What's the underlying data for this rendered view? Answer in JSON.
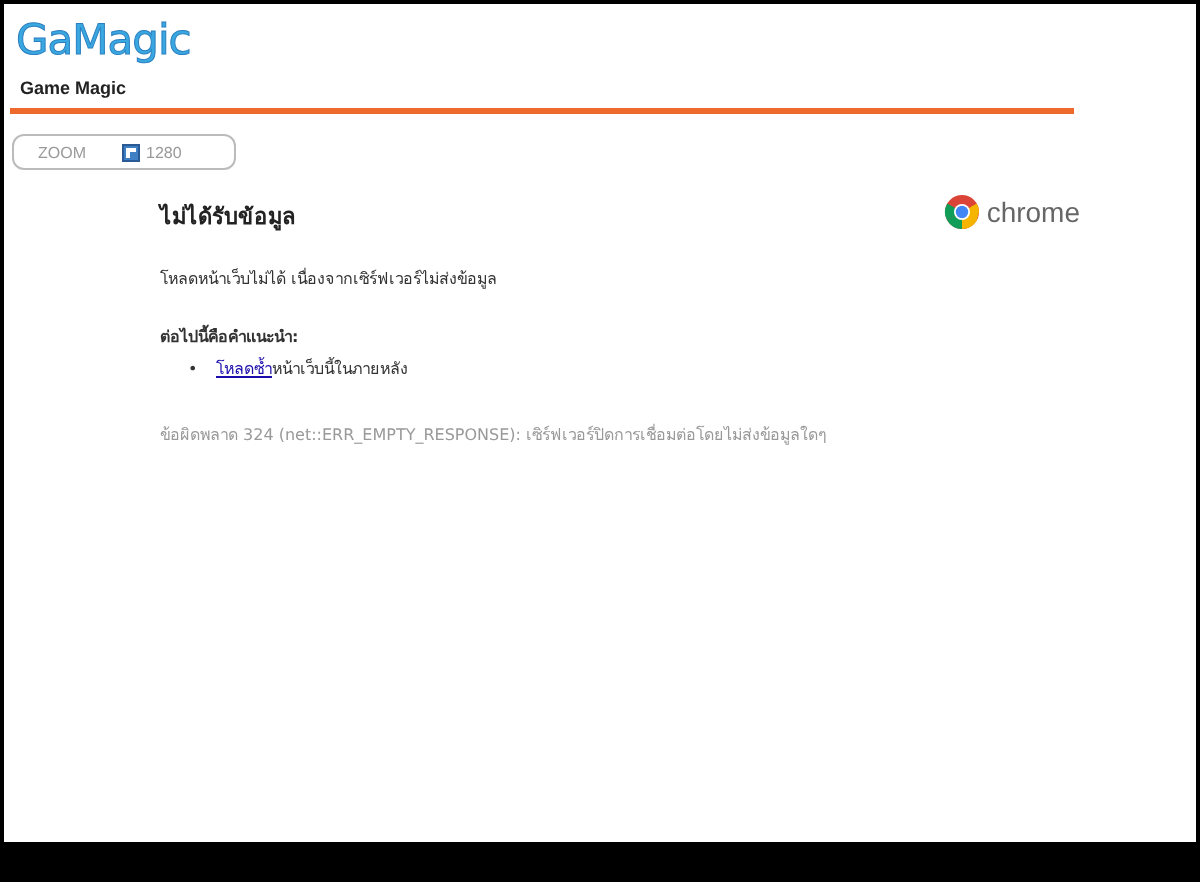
{
  "header": {
    "logo": "GaMagic",
    "subtitle": "Game Magic"
  },
  "zoom_bar": {
    "label": "ZOOM",
    "value": "1280"
  },
  "error": {
    "title": "ไม่ได้รับข้อมูล",
    "message": "โหลดหน้าเว็บไม่ได้ เนื่องจากเซิร์ฟเวอร์ไม่ส่งข้อมูล",
    "suggestions_heading": "ต่อไปนี้คือคำแนะนำ:",
    "suggestions": [
      {
        "bullet": "•",
        "link": "โหลดซ้ำ",
        "text": "หน้าเว็บนี้ในภายหลัง"
      }
    ],
    "details": "ข้อผิดพลาด 324 (net::ERR_EMPTY_RESPONSE): เซิร์ฟเวอร์ปิดการเชื่อมต่อโดยไม่ส่งข้อมูลใดๆ",
    "brand": "chrome"
  }
}
